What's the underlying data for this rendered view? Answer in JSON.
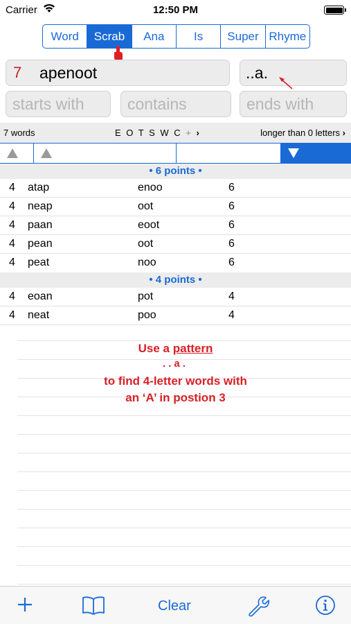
{
  "status": {
    "carrier": "Carrier",
    "time": "12:50 PM"
  },
  "tabs": [
    {
      "label": "Word",
      "active": false
    },
    {
      "label": "Scrab",
      "active": true
    },
    {
      "label": "Ana",
      "active": false
    },
    {
      "label": "Is",
      "active": false
    },
    {
      "label": "Super",
      "active": false
    },
    {
      "label": "Rhyme",
      "active": false
    }
  ],
  "inputs": {
    "letter_count": "7",
    "letters": "apenoot",
    "pattern": "..a.",
    "starts_placeholder": "starts with",
    "contains_placeholder": "contains",
    "ends_placeholder": "ends with"
  },
  "info": {
    "word_count": "7 words",
    "letters": "E O T S W C",
    "plus": "+",
    "length_filter": "longer than 0 letters"
  },
  "sections": [
    {
      "header": "• 6 points •",
      "rows": [
        [
          "4",
          "atap",
          "enoo",
          "6"
        ],
        [
          "4",
          "neap",
          "oot",
          "6"
        ],
        [
          "4",
          "paan",
          "eoot",
          "6"
        ],
        [
          "4",
          "pean",
          "oot",
          "6"
        ],
        [
          "4",
          "peat",
          "noo",
          "6"
        ]
      ]
    },
    {
      "header": "• 4 points •",
      "rows": [
        [
          "4",
          "eoan",
          "pot",
          "4"
        ],
        [
          "4",
          "neat",
          "poo",
          "4"
        ]
      ]
    }
  ],
  "annotation": {
    "line1_prefix": "Use a ",
    "line1_underlined": "pattern",
    "line2": "..a.",
    "line3": "to find 4-letter words with",
    "line4": "an ‘A’ in postion 3"
  },
  "toolbar": {
    "clear_label": "Clear"
  },
  "colors": {
    "accent": "#1a6ad6",
    "annotation": "#d92026",
    "count": "#c0262a"
  },
  "icons": [
    "wifi-icon",
    "battery-icon",
    "add-icon",
    "book-icon",
    "wrench-icon",
    "info-icon",
    "sort-ascending-icon",
    "sort-descending-icon",
    "tap-pointer-icon",
    "annotation-arrow-icon"
  ]
}
